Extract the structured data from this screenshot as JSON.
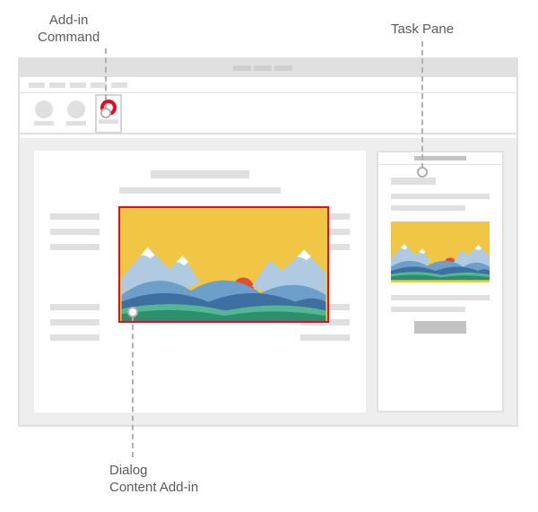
{
  "labels": {
    "addin_command": "Add-in\nCommand",
    "task_pane": "Task Pane",
    "dialog_content_addin": "Dialog\nContent Add-in"
  },
  "icons": {
    "addin_command": "addin-command-icon",
    "ribbon_button": "ribbon-button-icon"
  },
  "colors": {
    "accent_red": "#e50c1c",
    "sky_yellow": "#f1c644",
    "mountain_light": "#b0cbe1",
    "mountain_mid": "#6c9fc9",
    "mountain_dark": "#3d6fa0",
    "hills_green": "#2b8f6e",
    "hills_light": "#54b693",
    "snow": "#ffffff",
    "sun": "#e0502e",
    "ui_gray": "#e0e0e0"
  }
}
